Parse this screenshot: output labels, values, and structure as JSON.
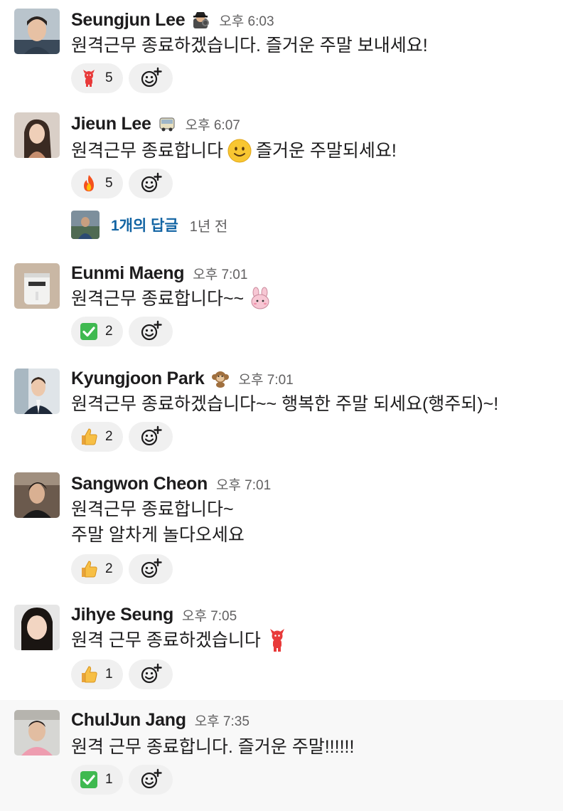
{
  "messages": [
    {
      "author": "Seungjun Lee",
      "status_icon": "detective-icon",
      "time": "오후 6:03",
      "lines": [
        {
          "text": "원격근무 종료하겠습니다. 즐거운 주말 보내세요!"
        }
      ],
      "reactions": [
        {
          "icon": "red-devil-icon",
          "count": "5"
        }
      ]
    },
    {
      "author": "Jieun Lee",
      "status_icon": "bus-icon",
      "time": "오후 6:07",
      "lines": [
        {
          "before": "원격근무 종료합니다",
          "emoji": "slight-smile-icon",
          "after": "즐거운 주말되세요!"
        }
      ],
      "reactions": [
        {
          "icon": "fire-icon",
          "count": "5"
        }
      ],
      "thread": {
        "replies": "1개의 답글",
        "time": "1년 전"
      }
    },
    {
      "author": "Eunmi Maeng",
      "time": "오후 7:01",
      "lines": [
        {
          "before": "원격근무 종료합니다~~",
          "emoji": "pink-bunny-icon",
          "after": ""
        }
      ],
      "reactions": [
        {
          "icon": "green-check-icon",
          "count": "2"
        }
      ]
    },
    {
      "author": "Kyungjoon Park",
      "status_icon": "monkey-icon",
      "time": "오후 7:01",
      "lines": [
        {
          "text": "원격근무 종료하겠습니다~~ 행복한 주말 되세요(행주되)~!"
        }
      ],
      "reactions": [
        {
          "icon": "thumbs-up-icon",
          "count": "2"
        }
      ]
    },
    {
      "author": "Sangwon Cheon",
      "time": "오후 7:01",
      "lines": [
        {
          "text": "원격근무 종료합니다~"
        },
        {
          "text": "주말 알차게 놀다오세요"
        }
      ],
      "reactions": [
        {
          "icon": "thumbs-up-icon",
          "count": "2"
        }
      ]
    },
    {
      "author": "Jihye Seung",
      "time": "오후 7:05",
      "lines": [
        {
          "before": "원격 근무 종료하겠습니다",
          "emoji": "red-devil-icon",
          "after": ""
        }
      ],
      "reactions": [
        {
          "icon": "thumbs-up-icon",
          "count": "1"
        }
      ]
    },
    {
      "author": "ChulJun Jang",
      "time": "오후 7:35",
      "lines": [
        {
          "text": "원격 근무 종료합니다. 즐거운 주말!!!!!!"
        }
      ],
      "reactions": [
        {
          "icon": "green-check-icon",
          "count": "1"
        }
      ],
      "highlighted": true
    }
  ],
  "add_reaction_icon": "add-reaction-icon",
  "colors": {
    "link": "#1264a3",
    "reaction_bg": "#f0f0f0",
    "highlight_bg": "#f8f8f8",
    "timestamp": "#616061"
  }
}
